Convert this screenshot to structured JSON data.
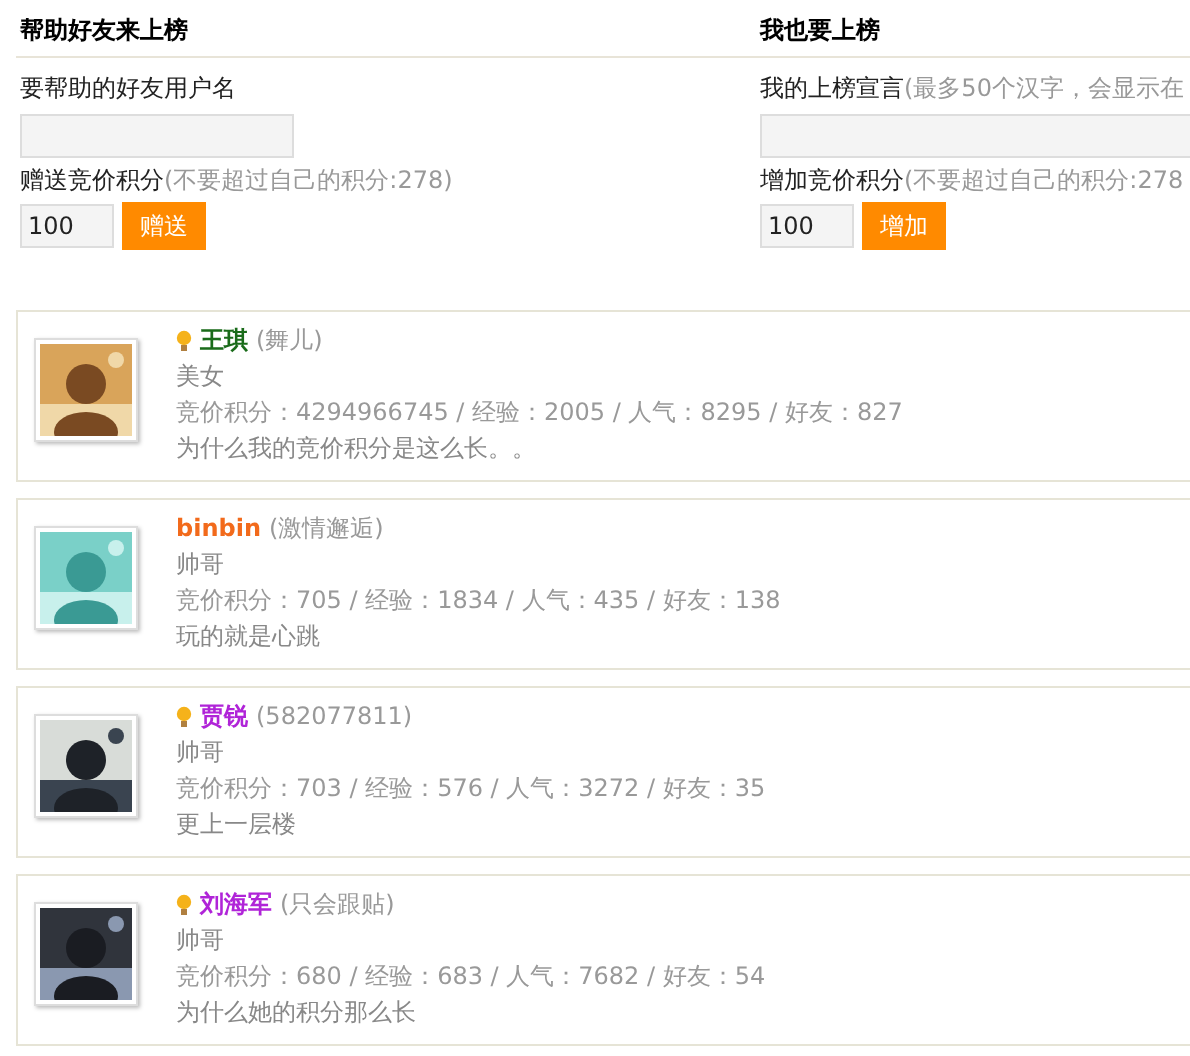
{
  "help_friend": {
    "title": "帮助好友来上榜",
    "username_label": "要帮助的好友用户名",
    "points_label": "赠送竞价积分",
    "points_hint": "(不要超过自己的积分:278)",
    "points_value": "100",
    "button": "赠送"
  },
  "self_rank": {
    "title": "我也要上榜",
    "motto_label": "我的上榜宣言",
    "motto_hint": "(最多50个汉字，会显示在",
    "points_label": "增加竞价积分",
    "points_hint": "(不要超过自己的积分:278",
    "points_value": "100",
    "button": "增加"
  },
  "users": [
    {
      "name": "王琪",
      "nickname": "(舞儿)",
      "vip": true,
      "color": "#1a6b1a",
      "title": "美女",
      "stats": "竞价积分：4294966745 / 经验：2005 / 人气：8295 / 好友：827",
      "motto": "为什么我的竞价积分是这么长。。"
    },
    {
      "name": "binbin",
      "nickname": "(激情邂逅)",
      "vip": false,
      "color": "#f26a1b",
      "title": "帅哥",
      "stats": "竞价积分：705 / 经验：1834 / 人气：435 / 好友：138",
      "motto": "玩的就是心跳"
    },
    {
      "name": "贾锐",
      "nickname": "(582077811)",
      "vip": true,
      "color": "#b024d8",
      "title": "帅哥",
      "stats": "竞价积分：703 / 经验：576 / 人气：3272 / 好友：35",
      "motto": "更上一层楼"
    },
    {
      "name": "刘海军",
      "nickname": "(只会跟贴)",
      "vip": true,
      "color": "#b024d8",
      "title": "帅哥",
      "stats": "竞价积分：680 / 经验：683 / 人气：7682 / 好友：54",
      "motto": "为什么她的积分那么长"
    }
  ]
}
